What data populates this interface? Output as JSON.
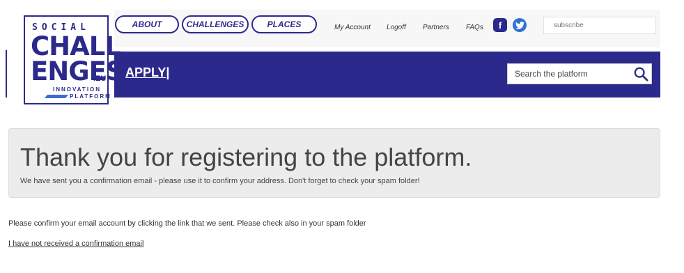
{
  "logo": {
    "line1": "SOCIAL",
    "line2": "CHALL",
    "line3": "ENGES",
    "suffix": ".EU",
    "tagline1": "INNOVATION",
    "tagline2": "PLATFORM"
  },
  "nav": {
    "pills": [
      "ABOUT",
      "CHALLENGES",
      "PLACES"
    ],
    "links": [
      "My Account",
      "Logoff",
      "Partners",
      "FAQs"
    ],
    "social": [
      {
        "icon": "facebook-icon",
        "glyph": "f"
      },
      {
        "icon": "twitter-icon",
        "glyph": "t"
      }
    ],
    "subscribe_placeholder": "subscribe"
  },
  "band": {
    "apply_label": "APPLY|",
    "search_placeholder": "Search the platform"
  },
  "notice": {
    "title": "Thank you for registering to the platform.",
    "subtitle": "We have sent you a confirmation email - please use it to confirm your address. Don't forget to check your spam folder!"
  },
  "body": {
    "message": "Please confirm your email account by clicking the link that we sent. Please check also in your spam folder",
    "resend_link": "I have not received a confirmation email"
  },
  "colors": {
    "brand": "#2b2a8c",
    "panel": "#ececec"
  }
}
